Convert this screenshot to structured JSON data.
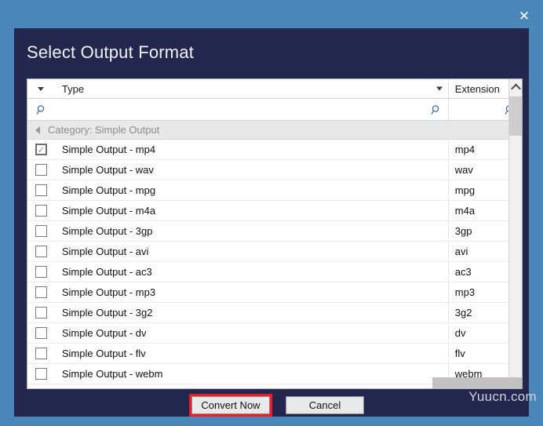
{
  "window": {
    "close_label": "✕",
    "accent_border": "#4a86b8",
    "dialog_bg": "#23264d"
  },
  "dialog": {
    "title": "Select Output Format"
  },
  "grid": {
    "columns": [
      {
        "key": "check",
        "label": ""
      },
      {
        "key": "type",
        "label": "Type"
      },
      {
        "key": "ext",
        "label": "Extension"
      }
    ],
    "filter_placeholder": "",
    "filter_values": {
      "type": "",
      "ext": ""
    },
    "category_label": "Category:  Simple Output",
    "rows": [
      {
        "type": "Simple Output - mp4",
        "ext": "mp4",
        "checked": true
      },
      {
        "type": "Simple Output - wav",
        "ext": "wav",
        "checked": false
      },
      {
        "type": "Simple Output - mpg",
        "ext": "mpg",
        "checked": false
      },
      {
        "type": "Simple Output - m4a",
        "ext": "m4a",
        "checked": false
      },
      {
        "type": "Simple Output - 3gp",
        "ext": "3gp",
        "checked": false
      },
      {
        "type": "Simple Output - avi",
        "ext": "avi",
        "checked": false
      },
      {
        "type": "Simple Output - ac3",
        "ext": "ac3",
        "checked": false
      },
      {
        "type": "Simple Output - mp3",
        "ext": "mp3",
        "checked": false
      },
      {
        "type": "Simple Output - 3g2",
        "ext": "3g2",
        "checked": false
      },
      {
        "type": "Simple Output - dv",
        "ext": "dv",
        "checked": false
      },
      {
        "type": "Simple Output - flv",
        "ext": "flv",
        "checked": false
      },
      {
        "type": "Simple Output - webm",
        "ext": "webm",
        "checked": false
      }
    ]
  },
  "buttons": {
    "convert_label": "Convert Now",
    "cancel_label": "Cancel",
    "highlight_color": "#ee1c25"
  },
  "watermark": {
    "text": "Yuucn.com"
  }
}
